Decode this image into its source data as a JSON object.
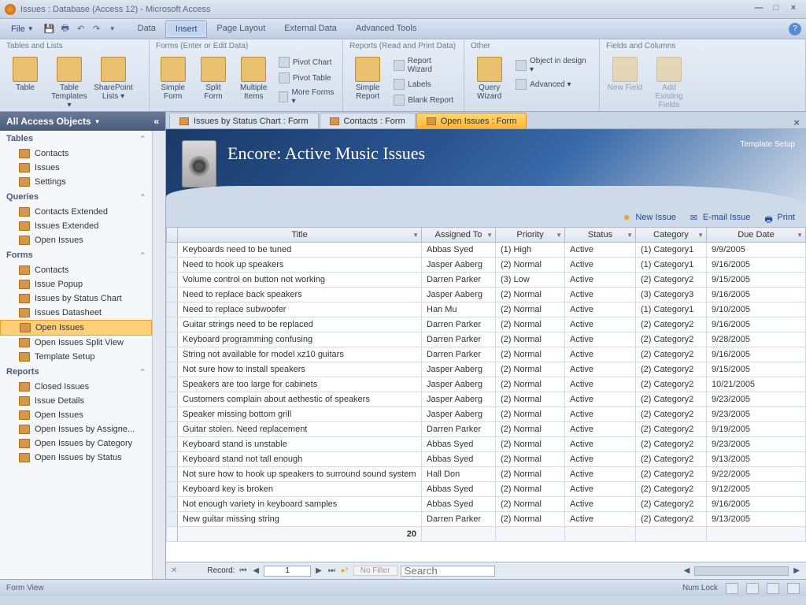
{
  "window": {
    "title": "Issues : Database (Access 12) - Microsoft Access"
  },
  "menu": {
    "file": "File",
    "tabs": [
      "Data",
      "Insert",
      "Page Layout",
      "External Data",
      "Advanced Tools"
    ],
    "active_tab": 1
  },
  "ribbon_groups": {
    "g0": {
      "title": "Tables and Lists",
      "btns": [
        "Table",
        "Table Templates ▾",
        "SharePoint Lists ▾"
      ]
    },
    "g1": {
      "title": "Forms (Enter or Edit Data)",
      "btns_big": [
        "Simple Form",
        "Split Form",
        "Multiple Items"
      ],
      "btns_sm": [
        "Pivot Chart",
        "Pivot Table",
        "More Forms ▾"
      ]
    },
    "g2": {
      "title": "Reports (Read and Print Data)",
      "btns_big": [
        "Simple Report"
      ],
      "btns_sm": [
        "Report Wizard",
        "Labels",
        "Blank Report"
      ]
    },
    "g3": {
      "title": "Other",
      "btns_big": [
        "Query Wizard"
      ],
      "btns_sm": [
        "Object in design ▾",
        "Advanced ▾"
      ]
    },
    "g4": {
      "title": "Fields and Columns",
      "btns": [
        "New Field",
        "Add Existing Fields"
      ]
    }
  },
  "nav": {
    "header": "All Access Objects",
    "sections": [
      {
        "name": "Tables",
        "items": [
          "Contacts",
          "Issues",
          "Settings"
        ]
      },
      {
        "name": "Queries",
        "items": [
          "Contacts Extended",
          "Issues Extended",
          "Open Issues"
        ]
      },
      {
        "name": "Forms",
        "items": [
          "Contacts",
          "Issue Popup",
          "Issues by Status Chart",
          "Issues Datasheet",
          "Open Issues",
          "Open Issues Split View",
          "Template Setup"
        ],
        "selected": "Open Issues"
      },
      {
        "name": "Reports",
        "items": [
          "Closed Issues",
          "Issue Details",
          "Open Issues",
          "Open Issues by Assigne...",
          "Open Issues by Category",
          "Open Issues by Status"
        ]
      }
    ]
  },
  "doctabs": {
    "tabs": [
      "Issues by Status Chart : Form",
      "Contacts : Form",
      "Open Issues : Form"
    ],
    "active": 2
  },
  "form": {
    "title": "Encore: Active Music Issues",
    "template_setup": "Template Setup",
    "actions": {
      "new": "New Issue",
      "email": "E-mail Issue",
      "print": "Print"
    }
  },
  "table": {
    "columns": [
      "Title",
      "Assigned To",
      "Priority",
      "Status",
      "Category",
      "Due Date"
    ],
    "rows": [
      [
        "Keyboards need to be tuned",
        "Abbas Syed",
        "(1) High",
        "Active",
        "(1) Category1",
        "9/9/2005"
      ],
      [
        "Need to hook up speakers",
        "Jasper Aaberg",
        "(2) Normal",
        "Active",
        "(1) Category1",
        "9/16/2005"
      ],
      [
        "Volume control on button not working",
        "Darren Parker",
        "(3) Low",
        "Active",
        "(2) Category2",
        "9/15/2005"
      ],
      [
        "Need to replace back speakers",
        "Jasper Aaberg",
        "(2) Normal",
        "Active",
        "(3) Category3",
        "9/16/2005"
      ],
      [
        "Need to replace subwoofer",
        "Han Mu",
        "(2) Normal",
        "Active",
        "(1) Category1",
        "9/10/2005"
      ],
      [
        "Guitar strings need to be replaced",
        "Darren Parker",
        "(2) Normal",
        "Active",
        "(2) Category2",
        "9/16/2005"
      ],
      [
        "Keyboard programming confusing",
        "Darren Parker",
        "(2) Normal",
        "Active",
        "(2) Category2",
        "9/28/2005"
      ],
      [
        "String not available for model xz10 guitars",
        "Darren Parker",
        "(2) Normal",
        "Active",
        "(2) Category2",
        "9/16/2005"
      ],
      [
        "Not sure how to install speakers",
        "Jasper Aaberg",
        "(2) Normal",
        "Active",
        "(2) Category2",
        "9/15/2005"
      ],
      [
        "Speakers are too large for cabinets",
        "Jasper Aaberg",
        "(2) Normal",
        "Active",
        "(2) Category2",
        "10/21/2005"
      ],
      [
        "Customers complain about aethestic of speakers",
        "Jasper Aaberg",
        "(2) Normal",
        "Active",
        "(2) Category2",
        "9/23/2005"
      ],
      [
        "Speaker missing bottom grill",
        "Jasper Aaberg",
        "(2) Normal",
        "Active",
        "(2) Category2",
        "9/23/2005"
      ],
      [
        "Guitar stolen. Need replacement",
        "Darren Parker",
        "(2) Normal",
        "Active",
        "(2) Category2",
        "9/19/2005"
      ],
      [
        "Keyboard stand is unstable",
        "Abbas Syed",
        "(2) Normal",
        "Active",
        "(2) Category2",
        "9/23/2005"
      ],
      [
        "Keyboard stand not tall enough",
        "Abbas Syed",
        "(2) Normal",
        "Active",
        "(2) Category2",
        "9/13/2005"
      ],
      [
        "Not sure how to hook up speakers to surround sound system",
        "Hall Don",
        "(2) Normal",
        "Active",
        "(2) Category2",
        "9/22/2005"
      ],
      [
        "Keyboard key is broken",
        "Abbas Syed",
        "(2) Normal",
        "Active",
        "(2) Category2",
        "9/12/2005"
      ],
      [
        "Not enough variety in keyboard samples",
        "Abbas Syed",
        "(2) Normal",
        "Active",
        "(2) Category2",
        "9/16/2005"
      ],
      [
        "New guitar missing string",
        "Darren Parker",
        "(2) Normal",
        "Active",
        "(2) Category2",
        "9/13/2005"
      ]
    ],
    "total": "20"
  },
  "recnav": {
    "label": "Record:",
    "current": "1",
    "nofilter": "No Filter",
    "search_placeholder": "Search"
  },
  "status": {
    "left": "Form View",
    "numlock": "Num Lock"
  }
}
